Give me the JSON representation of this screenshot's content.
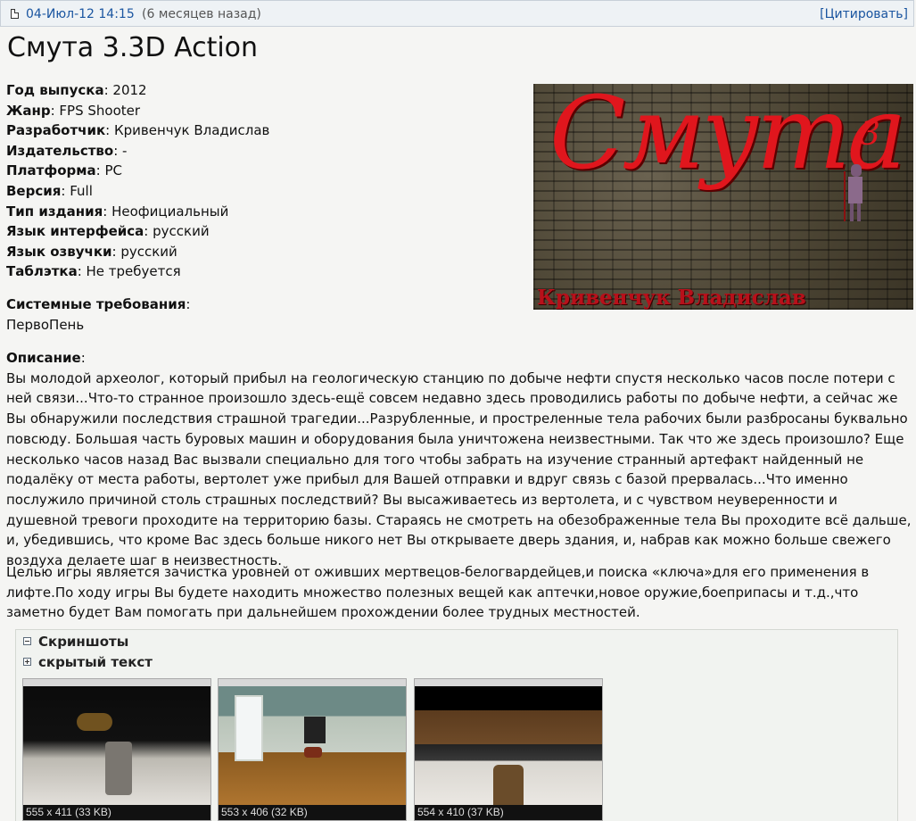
{
  "post": {
    "date": "04-Июл-12 14:15",
    "ago": "(6 месяцев назад)",
    "quote_label": "[Цитировать]"
  },
  "title": "Смута 3.3D Action",
  "cover": {
    "title_text": "Смута",
    "superscript": "3",
    "author_text": "Кривенчук Владислав"
  },
  "info": [
    {
      "label": "Год выпуска",
      "value": ": 2012"
    },
    {
      "label": "Жанр",
      "value": ": FPS Shooter"
    },
    {
      "label": "Разработчик",
      "value": ": Кривенчук Владислав"
    },
    {
      "label": "Издательство",
      "value": ": -"
    },
    {
      "label": "Платформа",
      "value": ": PC"
    },
    {
      "label": "Версия",
      "value": ": Full"
    },
    {
      "label": "Тип издания",
      "value": ": Неофициальный"
    },
    {
      "label": "Язык интерфейса",
      "value": ": русский"
    },
    {
      "label": "Язык озвучки",
      "value": ": русский"
    },
    {
      "label": "Таблэтка",
      "value": ": Не требуется"
    }
  ],
  "sysreq": {
    "label": "Системные требования",
    "colon": ":",
    "value": "ПервоПень"
  },
  "description": {
    "label": "Описание",
    "colon": ":",
    "text": "Вы молодой археолог, который прибыл на геологическую станцию по добыче нефти спустя несколько часов после потери с ней связи...Что-то странное произошло здесь-ещё совсем недавно здесь проводились работы по добыче нефти, а сейчас же Вы обнаружили последствия страшной трагедии...Разрубленные, и простреленные тела рабочих были разбросаны буквально повсюду. Большая часть буровых машин и оборудования была уничтожена неизвестными. Так что же здесь произошло? Еще несколько часов назад Вас вызвали специально для того чтобы забрать на изучение странный артефакт найденный не подалёку от места работы, вертолет уже прибыл для Вашей отправки и вдруг связь с базой прервалась...Что именно послужило причиной столь страшных последствий? Вы высаживаетесь из вертолета, и с чувством неуверенности и душевной тревоги проходите на территорию базы. Стараясь не смотреть на обезображенные тела Вы проходите всё дальше, и, убедившись, что кроме Вас здесь больше никого нет Вы открываете дверь здания, и, набрав как можно больше свежего воздуха делаете шаг в неизвестность."
  },
  "goal_text": "Целью игры является зачистка уровней от оживших мертвецов-белогвардейцев,и поиска «ключа»для его применения в лифте.По ходу игры Вы будете находить множество полезных вещей как аптечки,новое оружие,боеприпасы и т.д.,что заметно будет Вам помогать при дальнейшем прохождении более трудных местностей.",
  "spoilers": [
    {
      "label": "Скриншоты",
      "state": "expanded",
      "icon": "minus-icon"
    },
    {
      "label": "скрытый текст",
      "state": "collapsed",
      "icon": "plus-icon"
    }
  ],
  "screenshots": [
    {
      "caption": "555 x 411 (33 KB)"
    },
    {
      "caption": "553 x 406 (32 KB)"
    },
    {
      "caption": "554 x 410 (37 KB)"
    }
  ],
  "colors": {
    "link": "#1a55a0",
    "cover_red": "#e0161d",
    "header_bg": "#eef2f5"
  }
}
